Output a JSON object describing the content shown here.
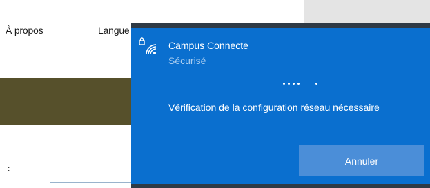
{
  "background_page": {
    "nav": [
      {
        "label": "À propos"
      },
      {
        "label": "Langue"
      }
    ],
    "colon_text": ":"
  },
  "network_flyout": {
    "network_name": "Campus Connecte",
    "status": "Sécurisé",
    "message": "Vérification de la configuration réseau nécessaire",
    "cancel_label": "Annuler",
    "icon": "wifi-secured-icon",
    "accent_color": "#0a6fcf",
    "button_color": "#4b8ed8"
  }
}
